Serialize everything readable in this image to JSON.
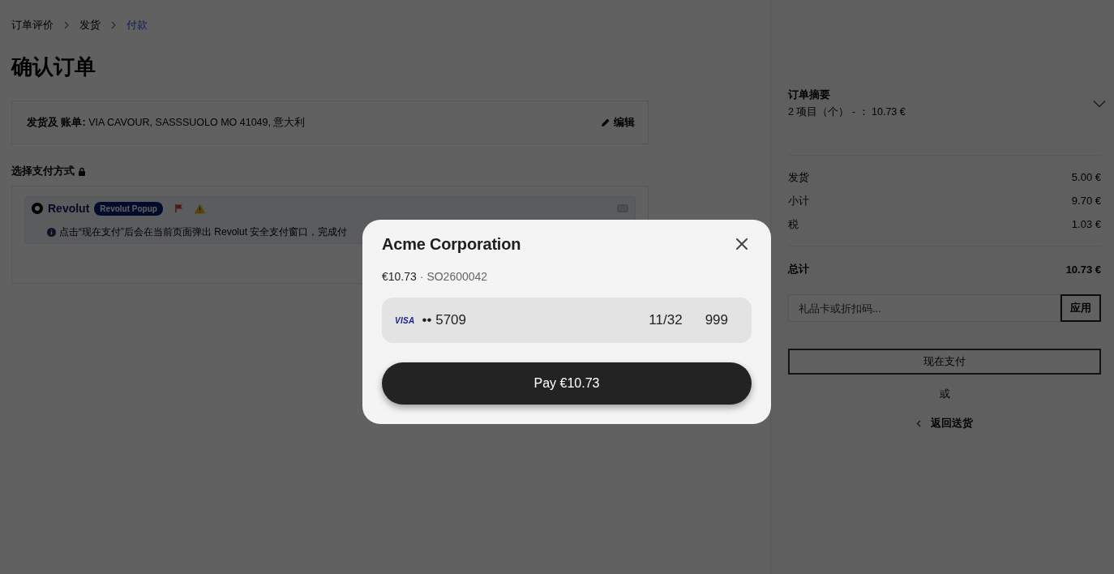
{
  "breadcrumb": [
    {
      "label": "订单评价",
      "selected": false
    },
    {
      "label": "发货",
      "selected": false
    },
    {
      "label": "付款",
      "selected": true
    }
  ],
  "title": "确认订单",
  "address": {
    "label": "发货及 账单:",
    "value": "VIA CAVOUR, SASSSUOLO MO 41049, 意大利",
    "edit": "编辑"
  },
  "payment": {
    "heading": "选择支付方式",
    "methods": [
      {
        "name": "Revolut",
        "badge": "Revolut Popup",
        "selected": true,
        "note": "点击“现在支付”后会在当前页面弹出 Revolut 安全支付窗口，完成付"
      }
    ]
  },
  "summary": {
    "title": "订单摘要",
    "details": "2 项目（个） - ： 10.73 €",
    "expanded": false,
    "lines": [
      {
        "label": "发货",
        "amount": "5.00 €"
      },
      {
        "label": "小计",
        "amount": "9.70 €"
      },
      {
        "label": "税",
        "amount": "1.03 €"
      }
    ],
    "total": {
      "label": "总计",
      "amount": "10.73 €"
    },
    "code_field": {
      "placeholder": "礼品卡或折扣码..."
    },
    "apply_button": "应用",
    "pay_button": "现在支付",
    "or": "或",
    "back_link": "返回送货"
  },
  "modal": {
    "merchant": "Acme Corporation",
    "amount": "€10.73",
    "reference": "· SO2600042",
    "card": {
      "brand": "VISA",
      "number": "•• 5709",
      "expiry": "11/32",
      "cvc": "999"
    },
    "pay_button": "Pay €10.73"
  }
}
